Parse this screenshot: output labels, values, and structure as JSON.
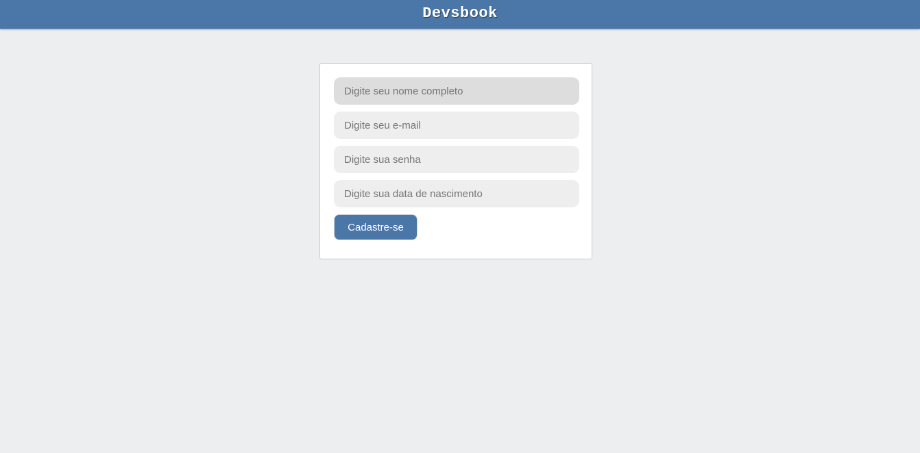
{
  "header": {
    "title": "Devsbook"
  },
  "form": {
    "name_placeholder": "Digite seu nome completo",
    "email_placeholder": "Digite seu e-mail",
    "password_placeholder": "Digite sua senha",
    "birthdate_placeholder": "Digite sua data de nascimento",
    "submit_label": "Cadastre-se"
  },
  "colors": {
    "brand": "#4a76a8",
    "background": "#edeef0",
    "field": "#eeeeee",
    "field_focused": "#dddddd"
  }
}
